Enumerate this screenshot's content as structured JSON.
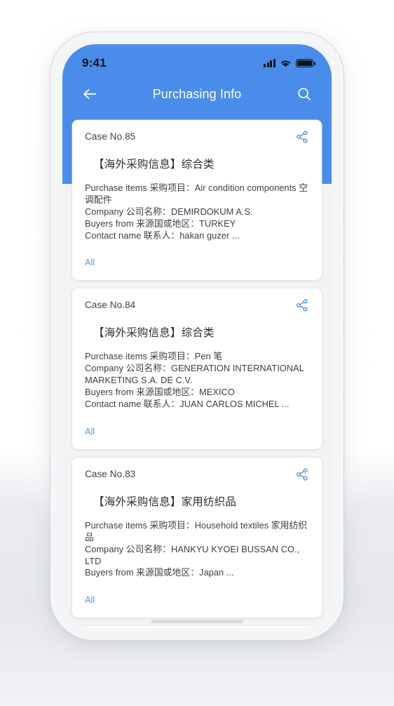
{
  "status_bar": {
    "time": "9:41",
    "icons": [
      "cellular-signal-icon",
      "wifi-icon",
      "battery-icon"
    ]
  },
  "nav": {
    "back_icon": "back-arrow-icon",
    "title": "Purchasing Info",
    "search_icon": "search-icon"
  },
  "theme": {
    "header_blue": "#4a8cea",
    "link_blue": "#5a93e0",
    "screen_bg": "#f2f3f5",
    "card_bg": "#ffffff",
    "body_text": "#3a3f47"
  },
  "cards": [
    {
      "case_no": "Case No.85",
      "title": "【海外采购信息】综合类",
      "share_icon": "share-icon",
      "lines": [
        "Purchase items 采购项目：Air condition components 空调配件",
        "Company 公司名称：DEMIRDOKUM A.S.",
        "Buyers from 来源国或地区：TURKEY",
        "Contact name 联系人：hakan guzer ..."
      ],
      "all_label": "All"
    },
    {
      "case_no": "Case No.84",
      "title": "【海外采购信息】综合类",
      "share_icon": "share-icon",
      "lines": [
        "Purchase items 采购项目：Pen 笔",
        "Company 公司名称：GENERATION INTERNATIONAL MARKETING S.A. DE C.V.",
        "Buyers from 来源国或地区：MEXICO",
        "Contact name 联系人：JUAN CARLOS MICHEL ..."
      ],
      "all_label": "All"
    },
    {
      "case_no": "Case No.83",
      "title": "【海外采购信息】家用纺织品",
      "share_icon": "share-icon",
      "lines": [
        "Purchase items 采购项目：Household textiles 家用纺织品",
        "Company 公司名称：HANKYU KYOEI BUSSAN CO., LTD",
        "Buyers from 来源国或地区：Japan ..."
      ],
      "all_label": "All"
    },
    {
      "case_no": "",
      "title": "",
      "share_icon": "share-icon",
      "lines": [],
      "all_label": ""
    }
  ],
  "home_indicator": "home-indicator-bar"
}
